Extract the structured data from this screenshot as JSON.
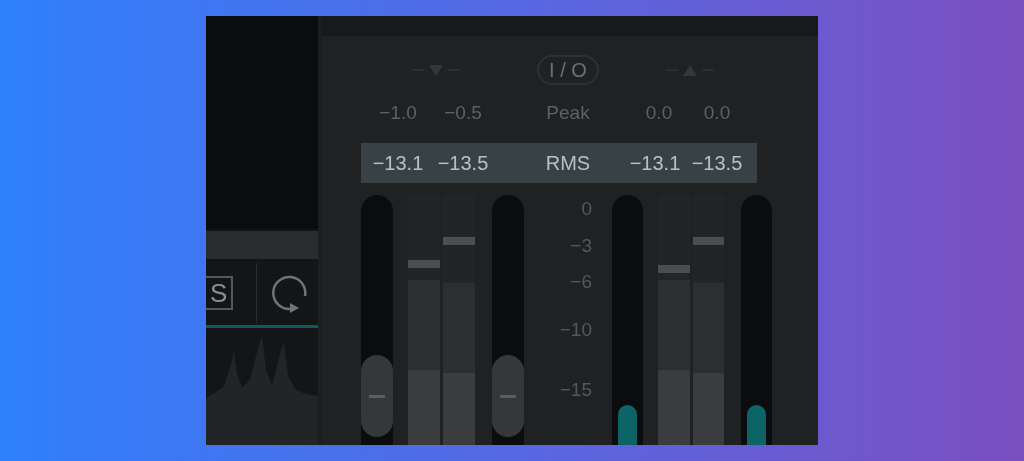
{
  "left": {
    "solo_button": "S"
  },
  "io_button": "I / O",
  "peak_label": "Peak",
  "rms_label": "RMS",
  "scale": [
    "0",
    "−3",
    "−6",
    "−10",
    "−15"
  ],
  "input": {
    "peak": [
      "−1.0",
      "−0.5"
    ],
    "rms": [
      "−13.1",
      "−13.5"
    ],
    "strips": [
      {
        "kind": "fader"
      },
      {
        "kind": "bar",
        "hold": {
          "level": 0.71
        },
        "peak": {
          "level": 0.66
        },
        "rms": {
          "level": 0.3
        }
      },
      {
        "kind": "bar",
        "hold": {
          "level": 0.8
        },
        "peak": {
          "level": 0.65
        },
        "rms": {
          "level": 0.29
        }
      },
      {
        "kind": "fader"
      }
    ]
  },
  "output": {
    "peak": [
      "0.0",
      "0.0"
    ],
    "rms": [
      "−13.1",
      "−13.5"
    ],
    "strips": [
      {
        "kind": "track",
        "level": 0.16
      },
      {
        "kind": "bar",
        "hold": {
          "level": 0.69
        },
        "peak": {
          "level": 0.66
        },
        "rms": {
          "level": 0.3
        }
      },
      {
        "kind": "bar",
        "hold": {
          "level": 0.8
        },
        "peak": {
          "level": 0.65
        },
        "rms": {
          "level": 0.29
        }
      },
      {
        "kind": "track",
        "level": 0.16
      }
    ]
  }
}
